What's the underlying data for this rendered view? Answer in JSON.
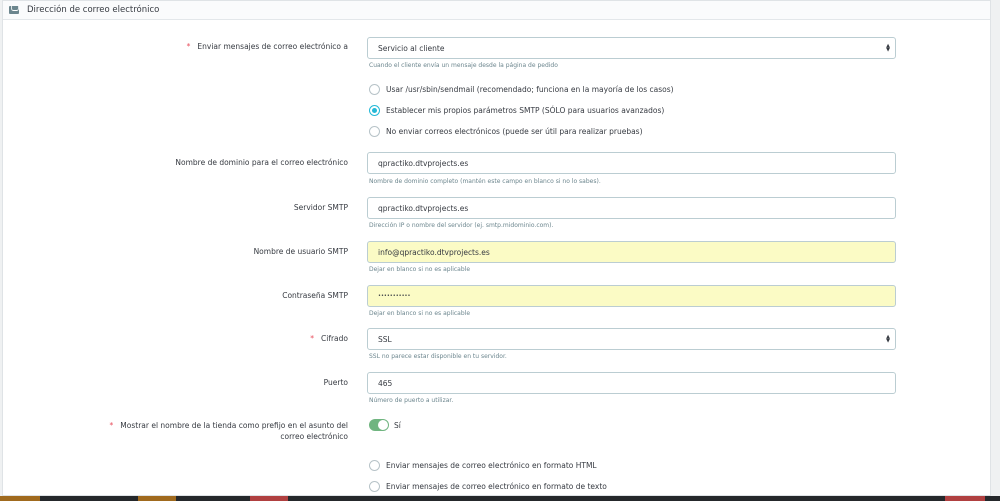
{
  "panel": {
    "title": "Dirección de correo electrónico",
    "icon": "envelope-icon"
  },
  "send_to": {
    "label": "Enviar mensajes de correo electrónico a",
    "value": "Servicio al cliente",
    "help": "Cuando el cliente envía un mensaje desde la página de pedido"
  },
  "method_options": [
    {
      "label": "Usar /usr/sbin/sendmail (recomendado; funciona en la mayoría de los casos)",
      "checked": false
    },
    {
      "label": "Establecer mis propios parámetros SMTP (SÓLO para usuarios avanzados)",
      "checked": true
    },
    {
      "label": "No enviar correos electrónicos (puede ser útil para realizar pruebas)",
      "checked": false
    }
  ],
  "domain": {
    "label": "Nombre de dominio para el correo electrónico",
    "value": "qpractiko.dtvprojects.es",
    "help": "Nombre de dominio completo (mantén este campo en blanco si no lo sabes)."
  },
  "smtp_server": {
    "label": "Servidor SMTP",
    "value": "qpractiko.dtvprojects.es",
    "help": "Dirección IP o nombre del servidor (ej. smtp.midominio.com)."
  },
  "smtp_user": {
    "label": "Nombre de usuario SMTP",
    "value": "info@qpractiko.dtvprojects.es",
    "help": "Dejar en blanco si no es aplicable"
  },
  "smtp_password": {
    "label": "Contraseña SMTP",
    "value": "•••••••••••",
    "help": "Dejar en blanco si no es aplicable"
  },
  "cipher": {
    "label": "Cifrado",
    "value": "SSL",
    "help": "SSL no parece estar disponible en tu servidor."
  },
  "port": {
    "label": "Puerto",
    "value": "465",
    "help": "Número de puerto a utilizar."
  },
  "prefix": {
    "label_line1": "Mostrar el nombre de la tienda como prefijo en el asunto del",
    "label_line2": "correo electrónico",
    "toggle_label": "Sí",
    "enabled": true
  },
  "format_options": [
    {
      "label": "Enviar mensajes de correo electrónico en formato HTML",
      "checked": false
    },
    {
      "label": "Enviar mensajes de correo electrónico en formato de texto",
      "checked": false
    }
  ],
  "required_mark": "*",
  "colors": {
    "accent": "#25b9d7",
    "toggle": "#70b580",
    "autofill": "#fbfbc5",
    "orange": "#a06a1e",
    "red": "#b04040"
  }
}
